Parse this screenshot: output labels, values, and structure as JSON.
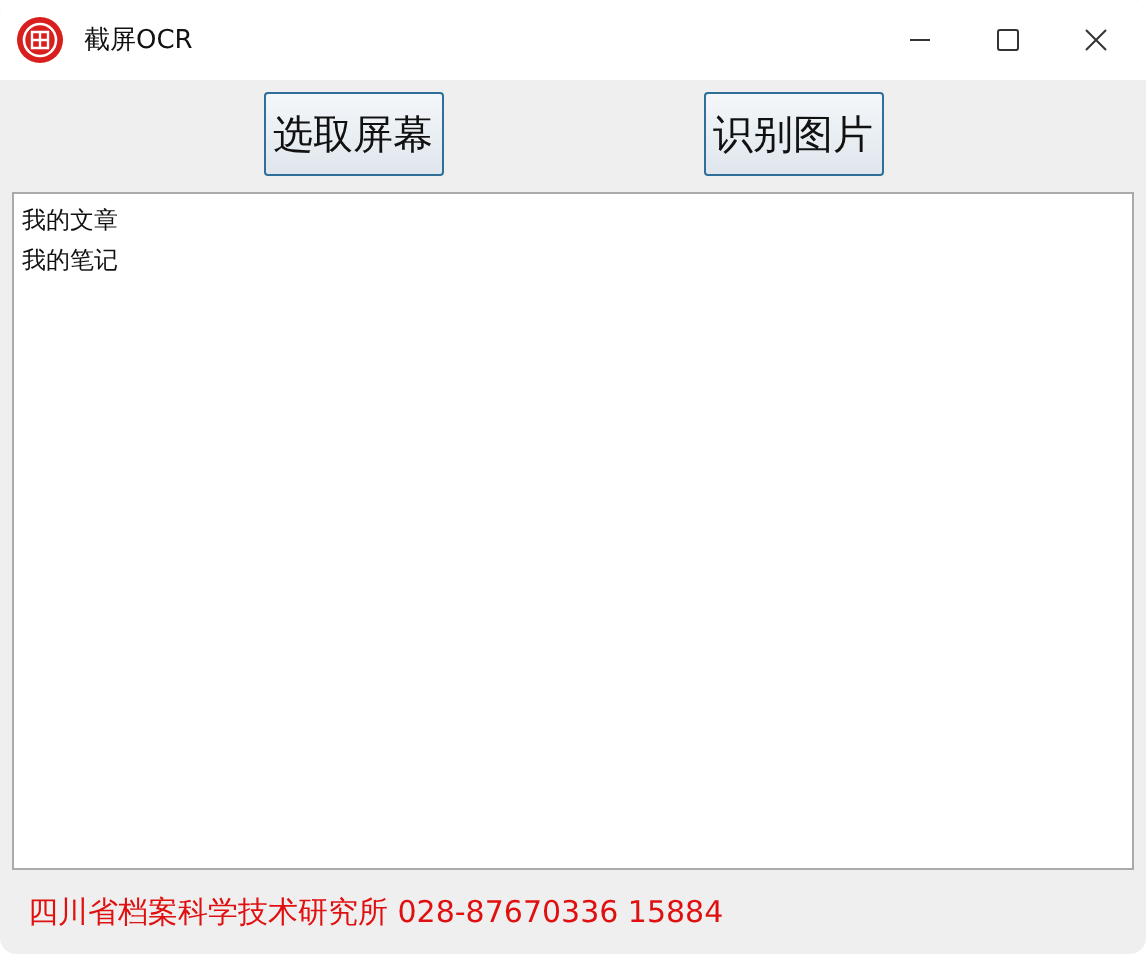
{
  "window": {
    "title": "截屏OCR"
  },
  "buttons": [
    "选取屏幕",
    "识别图片"
  ],
  "text_area": {
    "lines": [
      "我的文章",
      "我的笔记"
    ]
  },
  "footer": "四川省档案科学技术研究所 028-87670336 15884"
}
